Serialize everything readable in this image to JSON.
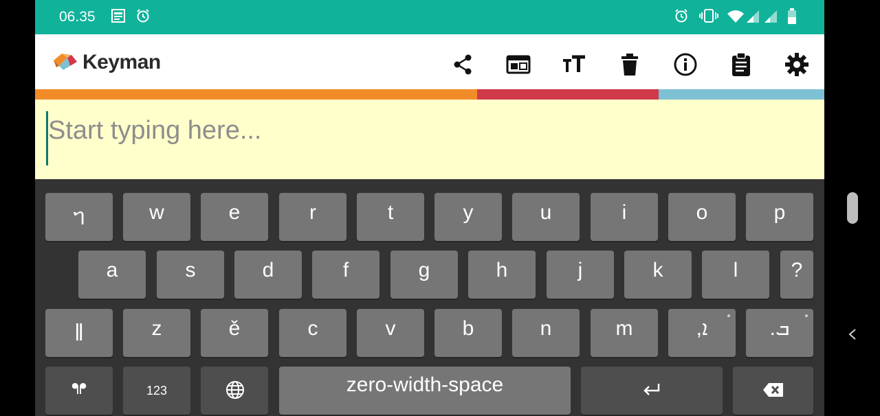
{
  "status_bar": {
    "time": "06.35",
    "icons_left": [
      "jazz-sim-icon",
      "alarm-icon"
    ],
    "icons_right": [
      "alarm-icon",
      "vibrate-icon",
      "wifi-icon",
      "signal-icon",
      "signal-icon",
      "battery-icon"
    ]
  },
  "app_bar": {
    "logo_text": "Keyman",
    "actions": [
      "share-icon",
      "keyboard-picker-icon",
      "text-size-icon",
      "delete-icon",
      "info-icon",
      "clipboard-icon",
      "settings-icon"
    ]
  },
  "editor": {
    "placeholder": "Start typing here..."
  },
  "keyboard": {
    "row1": [
      "ᥐ",
      "w",
      "e",
      "r",
      "t",
      "y",
      "u",
      "i",
      "o",
      "p"
    ],
    "row2": [
      "a",
      "s",
      "d",
      "f",
      "g",
      "h",
      "j",
      "k",
      "l",
      "?"
    ],
    "row3": [
      "ǁ",
      "z",
      "ě",
      "c",
      "v",
      "b",
      "n",
      "m",
      ",ܐ",
      ".ܒ"
    ],
    "row4": {
      "switch": "ᖳᖰ",
      "numeric": "123",
      "globe": "globe-icon",
      "space": "zero-width-space",
      "enter": "enter-icon",
      "backspace": "backspace-icon"
    }
  },
  "colors": {
    "status_bar": "#10b29a",
    "editor_bg": "#ffffcc",
    "stripe_orange": "#f28c28",
    "stripe_red": "#d0394a",
    "stripe_blue": "#7ec0d4",
    "key": "#767676",
    "key_dark": "#4e4e4e",
    "keyboard_bg": "#333333"
  }
}
